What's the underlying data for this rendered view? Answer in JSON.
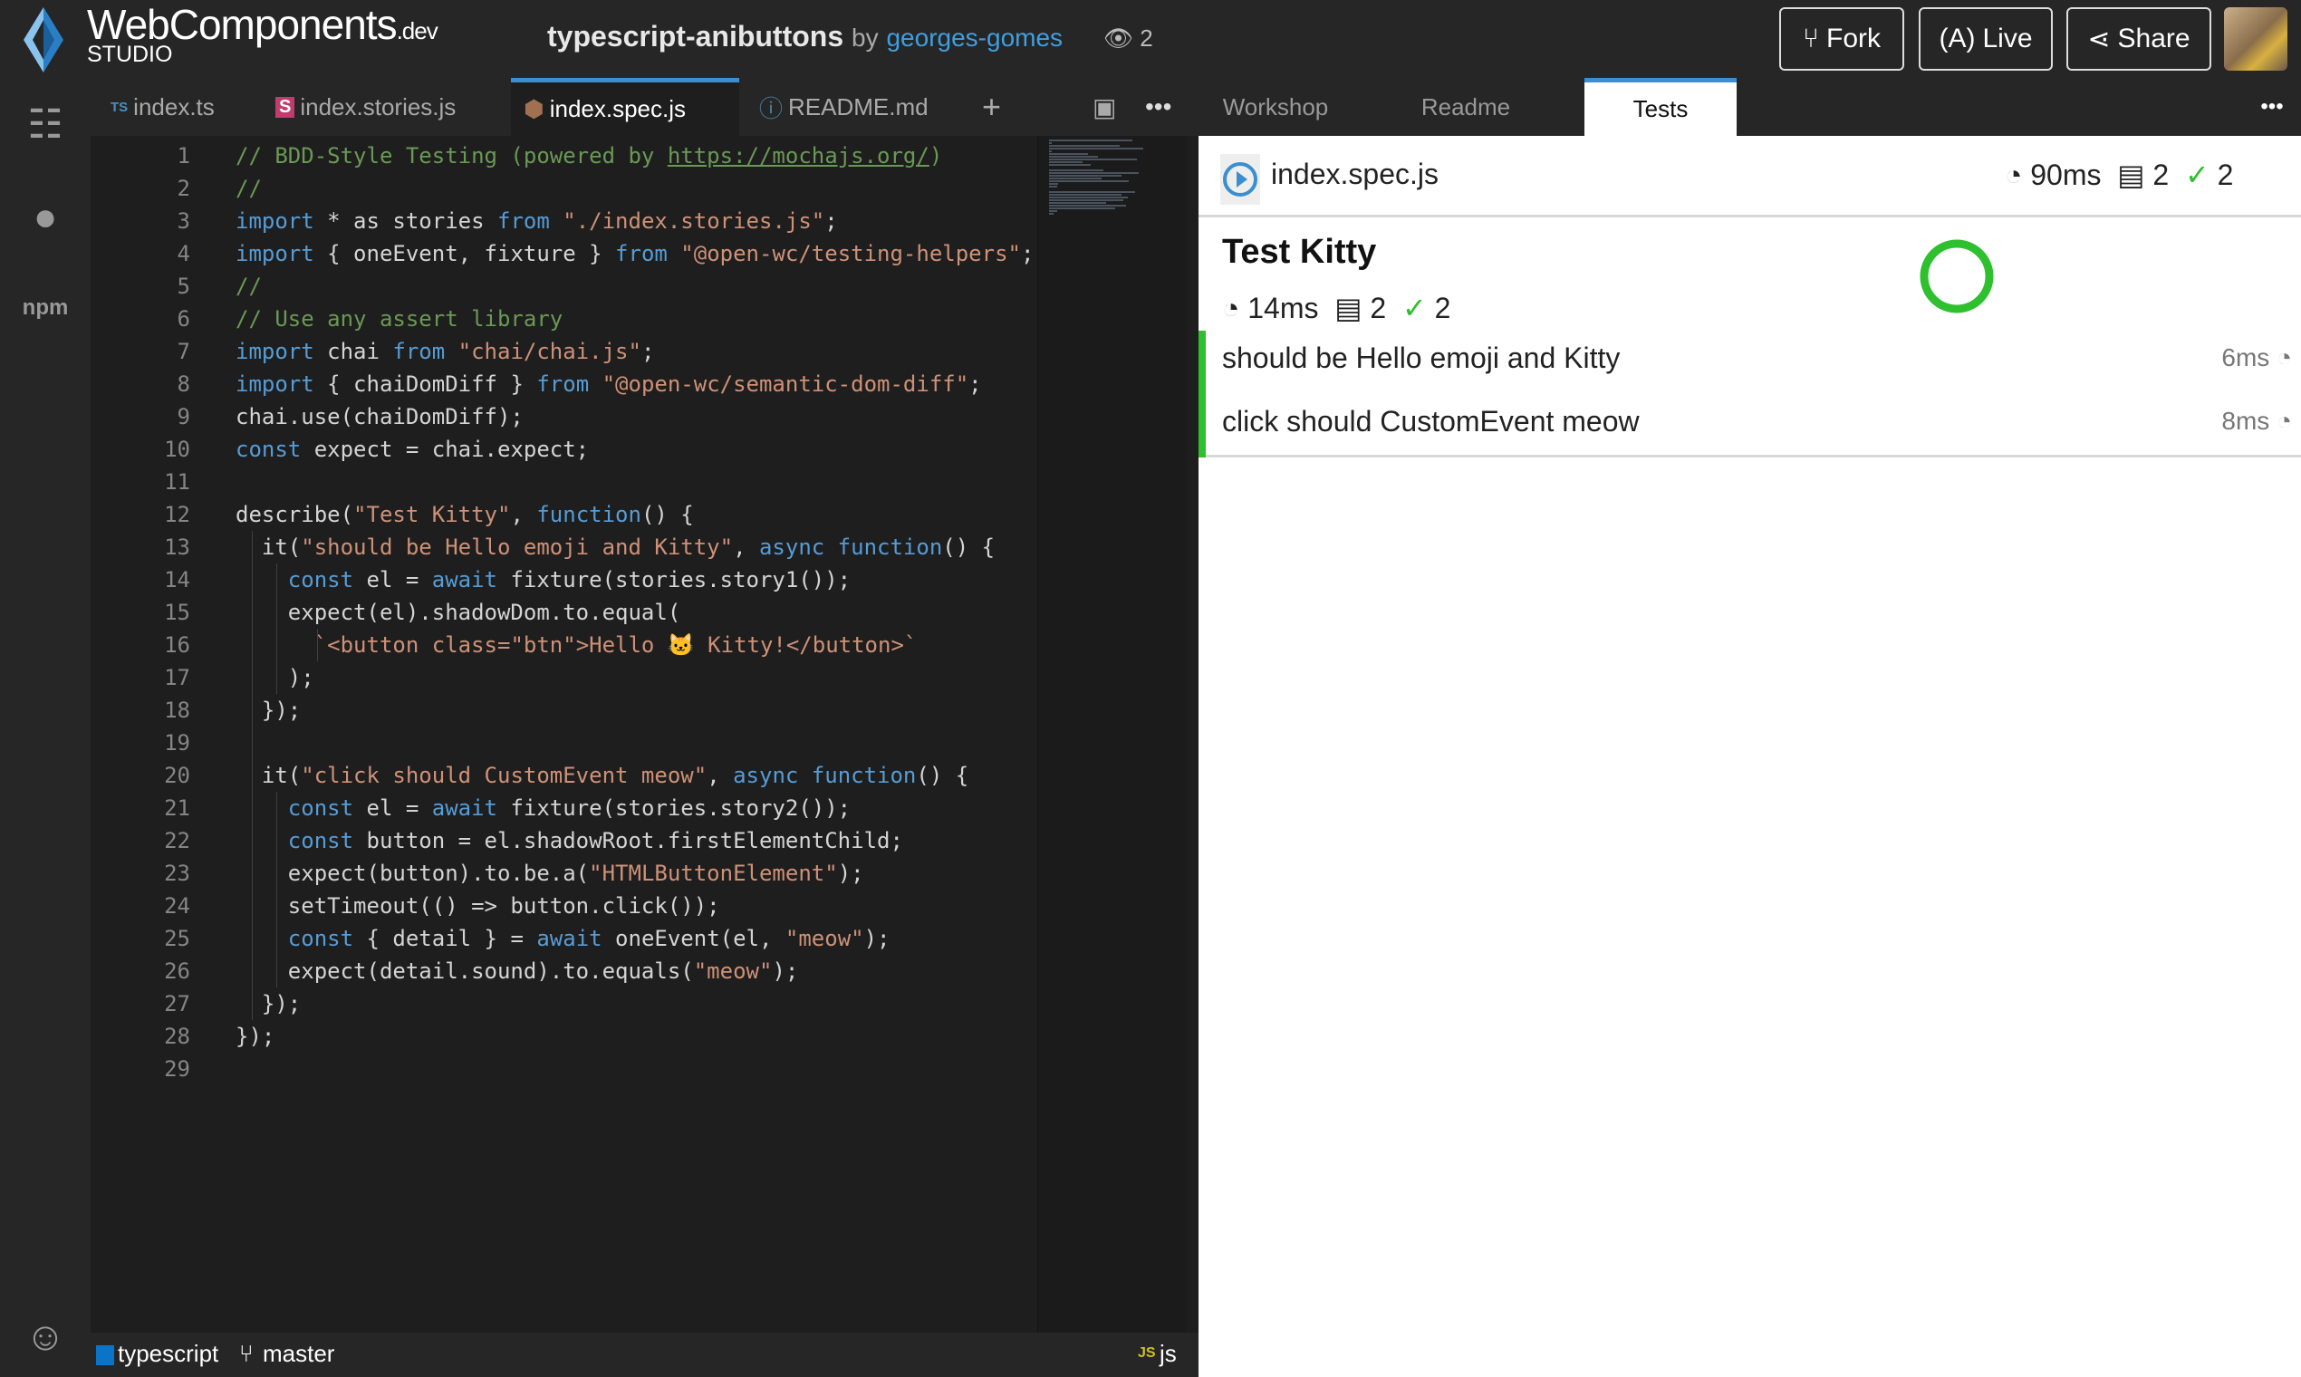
{
  "header": {
    "brand": "WebComponents",
    "brand_suffix": ".dev",
    "studio": "STUDIO",
    "project": "typescript-anibuttons",
    "by": "by",
    "author": "georges-gomes",
    "views": "2",
    "fork": "Fork",
    "live": "Live",
    "share": "Share"
  },
  "file_tabs": [
    {
      "badge": "TS",
      "label": "index.ts"
    },
    {
      "badge": "S",
      "label": "index.stories.js"
    },
    {
      "badge": "⬢",
      "label": "index.spec.js"
    },
    {
      "badge": "ⓘ",
      "label": "README.md"
    }
  ],
  "editor": {
    "lines": [
      [
        [
          "c",
          "// BDD-Style Testing (powered by "
        ],
        [
          "u",
          "https://mochajs.org/"
        ],
        [
          "c",
          ")"
        ]
      ],
      [
        [
          "c",
          "//"
        ]
      ],
      [
        [
          "k",
          "import"
        ],
        [
          "p",
          " * as stories "
        ],
        [
          "k",
          "from"
        ],
        [
          "p",
          " "
        ],
        [
          "s",
          "\"./index.stories.js\""
        ],
        [
          "p",
          ";"
        ]
      ],
      [
        [
          "k",
          "import"
        ],
        [
          "p",
          " { oneEvent, fixture } "
        ],
        [
          "k",
          "from"
        ],
        [
          "p",
          " "
        ],
        [
          "s",
          "\"@open-wc/testing-helpers\""
        ],
        [
          "p",
          ";"
        ]
      ],
      [
        [
          "c",
          "//"
        ]
      ],
      [
        [
          "c",
          "// Use any assert library"
        ]
      ],
      [
        [
          "k",
          "import"
        ],
        [
          "p",
          " chai "
        ],
        [
          "k",
          "from"
        ],
        [
          "p",
          " "
        ],
        [
          "s",
          "\"chai/chai.js\""
        ],
        [
          "p",
          ";"
        ]
      ],
      [
        [
          "k",
          "import"
        ],
        [
          "p",
          " { chaiDomDiff } "
        ],
        [
          "k",
          "from"
        ],
        [
          "p",
          " "
        ],
        [
          "s",
          "\"@open-wc/semantic-dom-diff\""
        ],
        [
          "p",
          ";"
        ]
      ],
      [
        [
          "p",
          "chai.use(chaiDomDiff);"
        ]
      ],
      [
        [
          "k",
          "const"
        ],
        [
          "p",
          " expect = chai.expect;"
        ]
      ],
      [],
      [
        [
          "p",
          "describe("
        ],
        [
          "s",
          "\"Test Kitty\""
        ],
        [
          "p",
          ", "
        ],
        [
          "k",
          "function"
        ],
        [
          "p",
          "() {"
        ]
      ],
      [
        [
          "p",
          "  it("
        ],
        [
          "s",
          "\"should be Hello emoji and Kitty\""
        ],
        [
          "p",
          ", "
        ],
        [
          "k",
          "async function"
        ],
        [
          "p",
          "() {"
        ]
      ],
      [
        [
          "p",
          "    "
        ],
        [
          "k",
          "const"
        ],
        [
          "p",
          " el = "
        ],
        [
          "k",
          "await"
        ],
        [
          "p",
          " fixture(stories.story1());"
        ]
      ],
      [
        [
          "p",
          "    expect(el).shadowDom.to.equal("
        ]
      ],
      [
        [
          "p",
          "      "
        ],
        [
          "s",
          "`<button class=\"btn\">Hello 🐱 Kitty!</button>`"
        ]
      ],
      [
        [
          "p",
          "    );"
        ]
      ],
      [
        [
          "p",
          "  });"
        ]
      ],
      [],
      [
        [
          "p",
          "  it("
        ],
        [
          "s",
          "\"click should CustomEvent meow\""
        ],
        [
          "p",
          ", "
        ],
        [
          "k",
          "async function"
        ],
        [
          "p",
          "() {"
        ]
      ],
      [
        [
          "p",
          "    "
        ],
        [
          "k",
          "const"
        ],
        [
          "p",
          " el = "
        ],
        [
          "k",
          "await"
        ],
        [
          "p",
          " fixture(stories.story2());"
        ]
      ],
      [
        [
          "p",
          "    "
        ],
        [
          "k",
          "const"
        ],
        [
          "p",
          " button = el.shadowRoot.firstElementChild;"
        ]
      ],
      [
        [
          "p",
          "    expect(button).to.be.a("
        ],
        [
          "s",
          "\"HTMLButtonElement\""
        ],
        [
          "p",
          ");"
        ]
      ],
      [
        [
          "p",
          "    setTimeout(() => button.click());"
        ]
      ],
      [
        [
          "p",
          "    "
        ],
        [
          "k",
          "const"
        ],
        [
          "p",
          " { detail } = "
        ],
        [
          "k",
          "await"
        ],
        [
          "p",
          " oneEvent(el, "
        ],
        [
          "s",
          "\"meow\""
        ],
        [
          "p",
          ");"
        ]
      ],
      [
        [
          "p",
          "    expect(detail.sound).to.equals("
        ],
        [
          "s",
          "\"meow\""
        ],
        [
          "p",
          ");"
        ]
      ],
      [
        [
          "p",
          "  });"
        ]
      ],
      [
        [
          "p",
          "});"
        ]
      ],
      []
    ]
  },
  "status": {
    "language": "typescript",
    "branch": "master",
    "mode_badge": "JS",
    "mode": "js"
  },
  "right_tabs": [
    "Workshop",
    "Readme",
    "Tests"
  ],
  "tests": {
    "file": "index.spec.js",
    "total_time": "90ms",
    "total_count": "2",
    "passed": "2",
    "suite": {
      "title": "Test Kitty",
      "time": "14ms",
      "count": "2",
      "passed": "2",
      "cases": [
        {
          "name": "should be Hello emoji and Kitty",
          "time": "6ms"
        },
        {
          "name": "click should CustomEvent meow",
          "time": "8ms"
        }
      ]
    }
  },
  "colors": {
    "accent": "#3b8fd0",
    "pass": "#2ec02e",
    "editor_bg": "#1e1e1e"
  }
}
